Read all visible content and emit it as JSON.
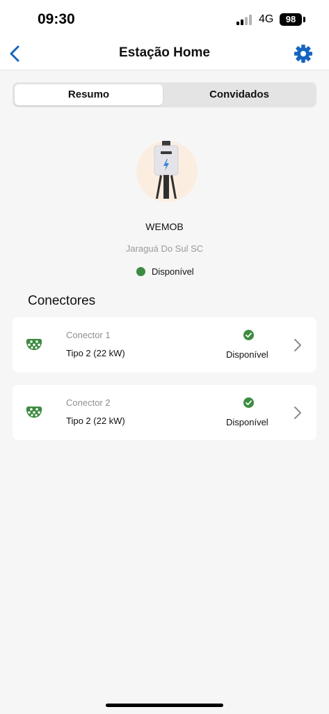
{
  "status_bar": {
    "time": "09:30",
    "network": "4G",
    "battery": "98",
    "signal_icon": "cellular-signal-icon"
  },
  "nav": {
    "title": "Estação Home",
    "back_icon": "chevron-left-icon",
    "settings_icon": "gear-icon"
  },
  "tabs": [
    {
      "label": "Resumo",
      "active": true
    },
    {
      "label": "Convidados",
      "active": false
    }
  ],
  "station": {
    "name": "WEMOB",
    "location": "Jaraguá Do Sul SC",
    "status": "Disponível",
    "status_color": "#3d8b41"
  },
  "connectors_title": "Conectores",
  "connectors": [
    {
      "name": "Conector 1",
      "type": "Tipo 2 (22 kW)",
      "status": "Disponível"
    },
    {
      "name": "Conector 2",
      "type": "Tipo 2 (22 kW)",
      "status": "Disponível"
    }
  ],
  "colors": {
    "accent": "#1565c0",
    "available_green": "#3d8b41",
    "background": "#f6f6f6"
  }
}
